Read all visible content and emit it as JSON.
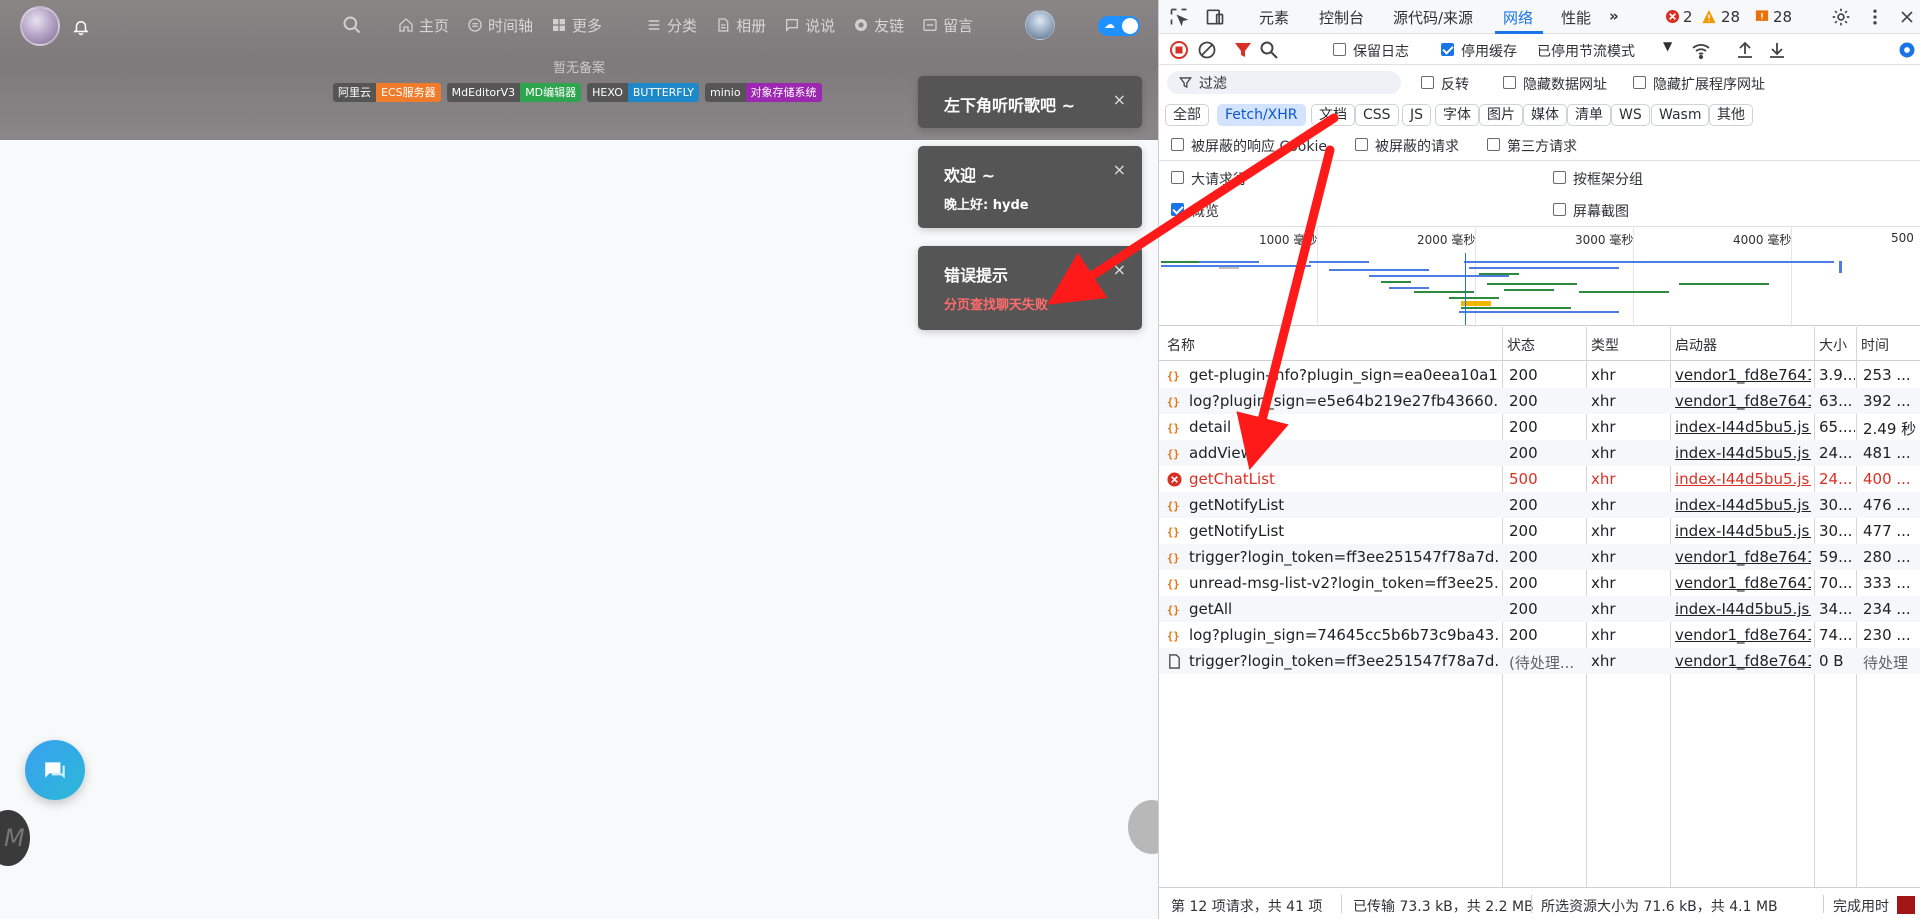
{
  "site": {
    "nav": [
      "主页",
      "时间轴",
      "更多",
      "分类",
      "相册",
      "说说",
      "友链",
      "留言"
    ],
    "beian": "暂无备案",
    "badges": [
      {
        "left": "阿里云",
        "right": "ECS服务器",
        "color": "#f07b2b"
      },
      {
        "left": "MdEditorV3",
        "right": "MD编辑器",
        "color": "#2ea44f"
      },
      {
        "left": "HEXO",
        "right": "BUTTERFLY",
        "color": "#1e88c8"
      },
      {
        "left": "minio",
        "right": "对象存储系统",
        "color": "#9c27b0"
      }
    ],
    "toasts": [
      {
        "title": "左下角听听歌吧 ~",
        "close": "×",
        "message": ""
      },
      {
        "title": "欢迎 ~",
        "close": "×",
        "message": "晚上好: hyde"
      },
      {
        "title": "错误提示",
        "close": "×",
        "message": "分页查找聊天失败",
        "message_color": "#ff6b6b"
      }
    ]
  },
  "devtools": {
    "tabs": [
      "元素",
      "控制台",
      "源代码/来源",
      "网络",
      "性能"
    ],
    "active_tab": "网络",
    "counts": {
      "errors": "2",
      "warnings": "28",
      "issues": "28"
    },
    "toolbar": {
      "preserve_log": "保留日志",
      "disable_cache": "停用缓存",
      "throttle": "已停用节流模式"
    },
    "filter": {
      "placeholder": "过滤",
      "invert": "反转",
      "hide_data_urls": "隐藏数据网址",
      "hide_ext_urls": "隐藏扩展程序网址"
    },
    "types": [
      "全部",
      "Fetch/XHR",
      "文档",
      "CSS",
      "JS",
      "字体",
      "图片",
      "媒体",
      "清单",
      "WS",
      "Wasm",
      "其他"
    ],
    "active_type": "Fetch/XHR",
    "options": {
      "blocked_cookies": "被屏蔽的响应 Cookie",
      "blocked_requests": "被屏蔽的请求",
      "third_party": "第三方请求",
      "big_rows": "大请求行",
      "group_by_frame": "按框架分组",
      "overview": "概览",
      "screenshots": "屏幕截图"
    },
    "overview_labels": [
      "1000 毫秒",
      "2000 毫秒",
      "3000 毫秒",
      "4000 毫秒",
      "500"
    ],
    "columns": {
      "name": "名称",
      "status": "状态",
      "type": "类型",
      "initiator": "启动器",
      "size": "大小",
      "time": "时间"
    },
    "requests": [
      {
        "name": "get-plugin-info?plugin_sign=ea0eea10a1...",
        "status": "200",
        "type": "xhr",
        "initiator": "vendor1_fd8e7641...",
        "size": "3.9...",
        "time": "253 ...",
        "error": false
      },
      {
        "name": "log?plugin_sign=e5e64b219e27fb43660...",
        "status": "200",
        "type": "xhr",
        "initiator": "vendor1_fd8e7641...",
        "size": "63...",
        "time": "392 ...",
        "error": false
      },
      {
        "name": "detail",
        "status": "200",
        "type": "xhr",
        "initiator": "index-I44d5bu5.js:1",
        "size": "65....",
        "time": "2.49 秒",
        "error": false
      },
      {
        "name": "addView",
        "status": "200",
        "type": "xhr",
        "initiator": "index-I44d5bu5.js:1",
        "size": "24...",
        "time": "481 ...",
        "error": false
      },
      {
        "name": "getChatList",
        "status": "500",
        "type": "xhr",
        "initiator": "index-I44d5bu5.js:1",
        "size": "24...",
        "time": "400 ...",
        "error": true
      },
      {
        "name": "getNotifyList",
        "status": "200",
        "type": "xhr",
        "initiator": "index-I44d5bu5.js:1",
        "size": "30...",
        "time": "476 ...",
        "error": false
      },
      {
        "name": "getNotifyList",
        "status": "200",
        "type": "xhr",
        "initiator": "index-I44d5bu5.js:1",
        "size": "30...",
        "time": "477 ...",
        "error": false
      },
      {
        "name": "trigger?login_token=ff3ee251547f78a7d...",
        "status": "200",
        "type": "xhr",
        "initiator": "vendor1_fd8e7641...",
        "size": "59...",
        "time": "280 ...",
        "error": false
      },
      {
        "name": "unread-msg-list-v2?login_token=ff3ee25...",
        "status": "200",
        "type": "xhr",
        "initiator": "vendor1_fd8e7641...",
        "size": "70...",
        "time": "333 ...",
        "error": false
      },
      {
        "name": "getAll",
        "status": "200",
        "type": "xhr",
        "initiator": "index-I44d5bu5.js:1",
        "size": "34...",
        "time": "234 ...",
        "error": false
      },
      {
        "name": "log?plugin_sign=74645cc5b6b73c9ba43...",
        "status": "200",
        "type": "xhr",
        "initiator": "vendor1_fd8e7641...",
        "size": "74...",
        "time": "230 ...",
        "error": false
      },
      {
        "name": "trigger?login_token=ff3ee251547f78a7d...",
        "status": "(待处理...",
        "type": "xhr",
        "initiator": "vendor1_fd8e7641...",
        "size": "0 B",
        "time": "待处理",
        "error": false,
        "pending": true
      }
    ],
    "status_bar": {
      "requests": "第 12 项请求，共 41 项",
      "transferred": "已传输 73.3 kB，共 2.2 MB",
      "resources": "所选资源大小为 71.6 kB，共 4.1 MB",
      "finish": "完成用时"
    }
  },
  "colors": {
    "accent": "#1a73e8",
    "error": "#d93025",
    "arrow": "#ff1a1a"
  }
}
